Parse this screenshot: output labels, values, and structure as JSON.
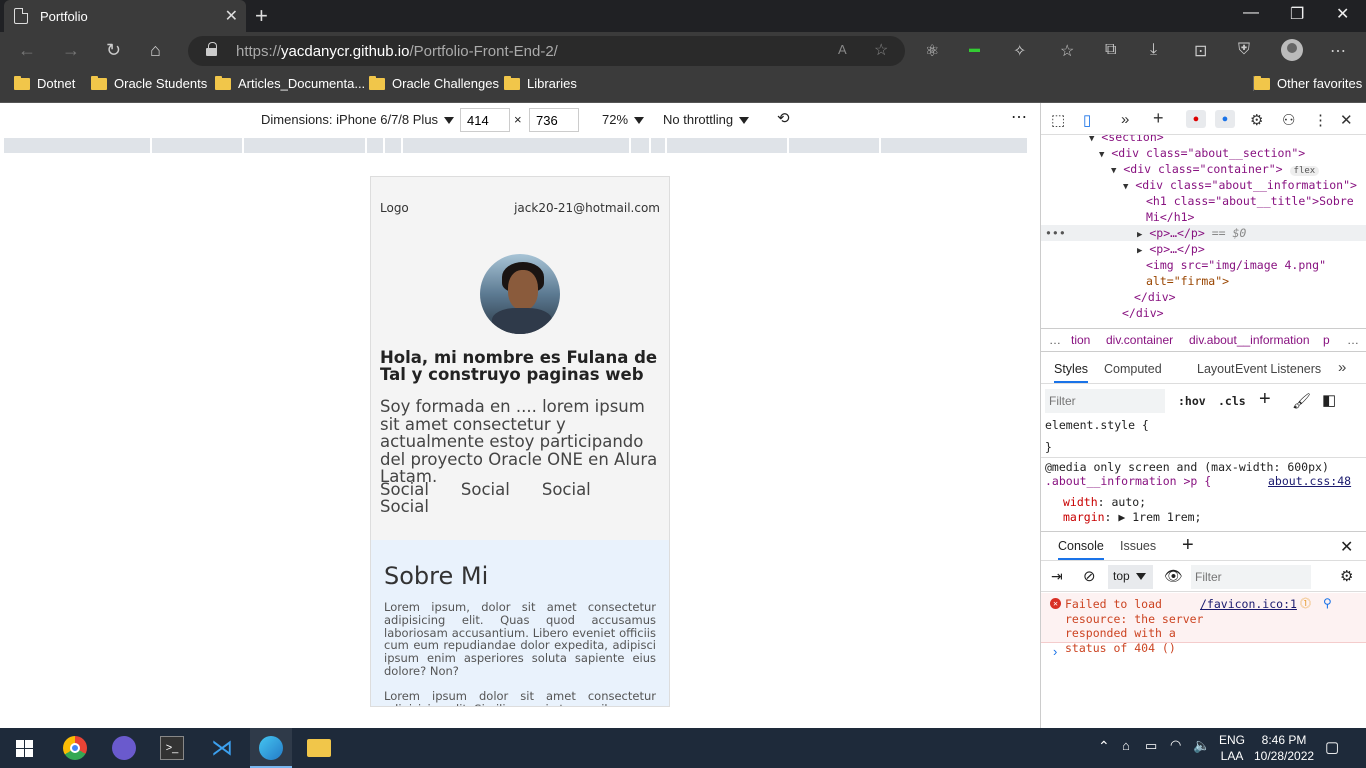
{
  "browser": {
    "tab_title": "Portfolio",
    "url_scheme": "https://",
    "url_host": "yacdanycr.github.io",
    "url_path": "/Portfolio-Front-End-2/",
    "bookmarks": [
      "Dotnet",
      "Oracle Students",
      "Articles_Documenta...",
      "Oracle Challenges",
      "Libraries"
    ],
    "other_favorites": "Other favorites"
  },
  "device_toolbar": {
    "dimensions_label": "Dimensions: iPhone 6/7/8 Plus",
    "width": "414",
    "times": "×",
    "height": "736",
    "zoom": "72%",
    "throttling": "No throttling"
  },
  "page": {
    "logo": "Logo",
    "email": "jack20-21@hotmail.com",
    "heading": "Hola, mi nombre es Fulana de Tal y construyo paginas web",
    "intro": "Soy formada en .... lorem ipsum sit amet consectetur y actualmente estoy participando del proyecto Oracle ONE en Alura Latam.",
    "socials": [
      "Social",
      "Social",
      "Social",
      "Social"
    ],
    "about_title": "Sobre Mi",
    "about_p1": "Lorem ipsum, dolor sit amet consectetur adipisicing elit. Quas quod accusamus laboriosam accusantium. Libero eveniet officiis cum eum repudiandae dolor expedita, adipisci ipsum enim asperiores soluta sapiente eius dolore? Non?",
    "about_p2": "Lorem ipsum dolor sit amet consectetur adipisicing elit. Similique quia temporibus"
  },
  "devtools": {
    "elements": [
      {
        "indent": 0,
        "text": "<section>"
      },
      {
        "indent": 1,
        "text": "<div class=\"about__section\">"
      },
      {
        "indent": 2,
        "text": "<div class=\"container\">",
        "badge": "flex"
      },
      {
        "indent": 3,
        "text": "<div class=\"about__information\">"
      },
      {
        "indent": 4,
        "text": "<h1 class=\"about__title\">Sobre"
      },
      {
        "indent": 4,
        "text": "Mi</h1>"
      },
      {
        "indent": 4,
        "text": "<p>…</p>",
        "suffix": "== $0"
      },
      {
        "indent": 4,
        "text": "<p>…</p>"
      },
      {
        "indent": 4,
        "text": "<img src=\"img/image 4.png\""
      },
      {
        "indent": 4,
        "text": "alt=\"firma\">"
      },
      {
        "indent": 3,
        "text": "</div>"
      },
      {
        "indent": 2,
        "text": "</div>"
      }
    ],
    "breadcrumb": [
      "tion",
      "div.container",
      "div.about__information",
      "p"
    ],
    "style_tabs": [
      "Styles",
      "Computed",
      "Layout",
      "Event Listeners"
    ],
    "filter_placeholder": "Filter",
    "hov": ":hov",
    "cls": ".cls",
    "element_style": "element.style {",
    "close_brace": "}",
    "media_rule": "@media only screen and (max-width: 600px)",
    "selector": ".about__information >p {",
    "source_link": "about.css:48",
    "prop1_name": "width",
    "prop1_value": "auto;",
    "prop2_name": "margin",
    "prop2_value": "1rem 1rem;",
    "console_tabs": [
      "Console",
      "Issues"
    ],
    "console_context": "top",
    "console_filter": "Filter",
    "error_text": "Failed to load resource: the server responded with a status of 404 ()",
    "error_source": "/favicon.ico:1"
  },
  "taskbar": {
    "lang1": "ENG",
    "lang2": "LAA",
    "time": "8:46 PM",
    "date": "10/28/2022"
  }
}
